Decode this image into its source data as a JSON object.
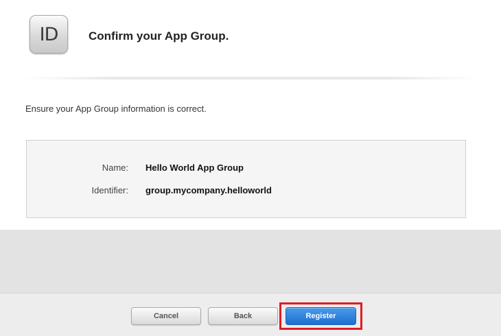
{
  "header": {
    "icon_text": "ID",
    "title": "Confirm your App Group."
  },
  "intro_text": "Ensure your App Group information is correct.",
  "details": [
    {
      "label": "Name:",
      "value": "Hello World App Group"
    },
    {
      "label": "Identifier:",
      "value": "group.mycompany.helloworld"
    }
  ],
  "footer": {
    "cancel_label": "Cancel",
    "back_label": "Back",
    "register_label": "Register"
  },
  "colors": {
    "primary_button": "#1c6fd0",
    "highlight_border": "#e01b24"
  }
}
